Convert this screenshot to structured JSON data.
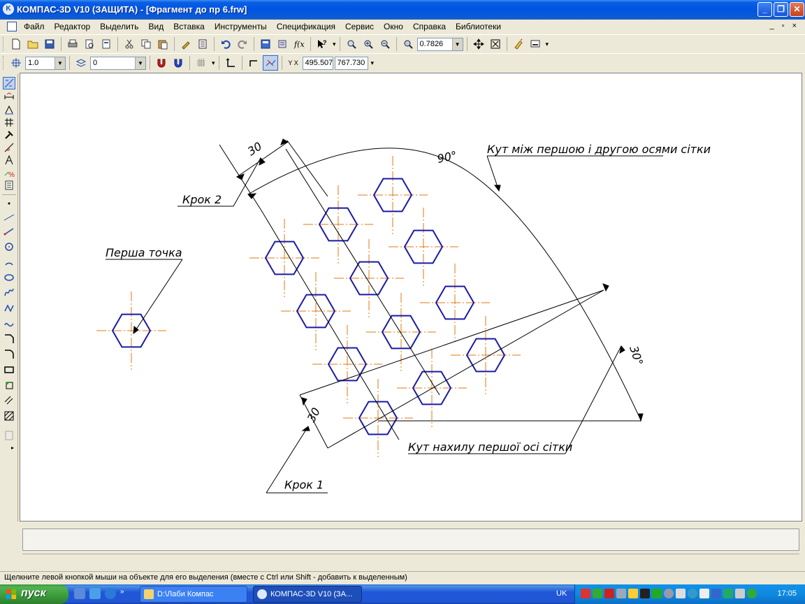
{
  "window": {
    "title": "КОМПАС-3D V10 (ЗАЩИТА) - [Фрагмент до пр 6.frw]"
  },
  "menu": {
    "items": [
      "Файл",
      "Редактор",
      "Выделить",
      "Вид",
      "Вставка",
      "Инструменты",
      "Спецификация",
      "Сервис",
      "Окно",
      "Справка",
      "Библиотеки"
    ],
    "mdi_controls": "_ ▫ ×"
  },
  "toolbar": {
    "zoom_value": "0.7826"
  },
  "props_toolbar": {
    "step_value": "1.0",
    "layer_value": "0",
    "coord_x": "495.507",
    "coord_y": "767.730",
    "coord_caption": "Y X"
  },
  "drawing": {
    "labels": {
      "persha_tochka": "Перша точка",
      "krok1": "Крок 1",
      "krok2": "Крок 2",
      "kut_mizh": "Кут між першою і другою осями сітки",
      "kut_nakhylu": "Кут нахилу першої осі сітки",
      "dim_30_step2": "30",
      "dim_30_step1": "30",
      "angle_90": "90°",
      "angle_30": "30°"
    },
    "colors": {
      "hexagon": "#1a1aa8",
      "axis": "#e07a10",
      "dimension": "#000000"
    },
    "hexagon_count": 12
  },
  "statusbar": {
    "hint": "Щелкните левой кнопкой мыши на объекте для его выделения (вместе с Ctrl или Shift - добавить к выделенным)"
  },
  "taskbar": {
    "start_label": "пуск",
    "tasks": [
      {
        "label": "D:\\Лаби Компас"
      },
      {
        "label": "КОМПАС-3D V10 (ЗА..."
      }
    ],
    "language": "UK",
    "clock": "17:05"
  }
}
